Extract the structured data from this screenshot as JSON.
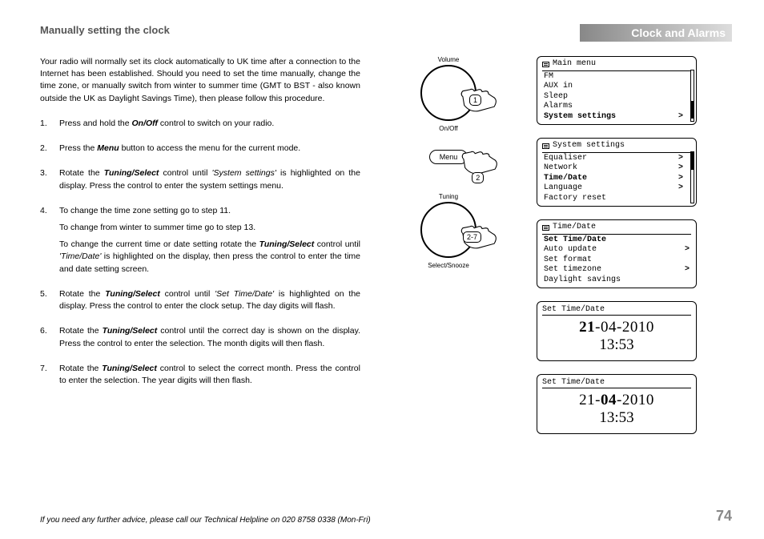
{
  "header": {
    "section_title": "Manually setting the clock",
    "chapter": "Clock and Alarms"
  },
  "intro": "Your radio will normally set its clock automatically to UK time after a connection to the Internet has been established. Should you need to set the time manually, change the time zone, or manually switch from winter to summer time (GMT to BST - also known outside the UK as Daylight Savings Time), then please follow this procedure.",
  "steps": {
    "s1_a": "Press and hold the ",
    "s1_b": "On/Off",
    "s1_c": " control to switch on your radio.",
    "s2_a": "Press the ",
    "s2_b": "Menu",
    "s2_c": " button to access the menu for the current mode.",
    "s3_a": "Rotate the ",
    "s3_b": "Tuning/Select",
    "s3_c": " control until ",
    "s3_d": "'System settings'",
    "s3_e": " is highlighted on the display. Press the control to enter the system settings menu.",
    "s4_a": "To change the time zone setting go to step 11.",
    "s4_b": "To change from winter to summer time go to step 13.",
    "s4_c1": "To change the current time or date setting rotate the ",
    "s4_c2": "Tuning/Select",
    "s4_c3": " control until ",
    "s4_c4": "'Time/Date'",
    "s4_c5": " is highlighted on the display, then press the control to enter the time and date setting screen.",
    "s5_a": "Rotate the ",
    "s5_b": "Tuning/Select",
    "s5_c": " control until ",
    "s5_d": "'Set Time/Date'",
    "s5_e": " is highlighted on the display. Press the control to enter the clock setup. The day digits will flash.",
    "s6_a": "Rotate the ",
    "s6_b": "Tuning/Select",
    "s6_c": " control until the correct day is shown on the display. Press the control to enter the selection. The month digits will then flash.",
    "s7_a": "Rotate the ",
    "s7_b": "Tuning/Select",
    "s7_c": " control to select the correct month. Press the control to enter the selection. The year digits will then flash."
  },
  "diagrams": {
    "d1": {
      "top": "Volume",
      "bottom": "On/Off",
      "badge": "1"
    },
    "d2": {
      "label": "Menu",
      "badge": "2"
    },
    "d3": {
      "top": "Tuning",
      "bottom": "Select/Snooze",
      "badge": "2-7"
    }
  },
  "screens": {
    "main_menu": {
      "title": "Main menu",
      "items": [
        {
          "label": "FM",
          "arrow": "",
          "bold": false
        },
        {
          "label": "AUX in",
          "arrow": "",
          "bold": false
        },
        {
          "label": "Sleep",
          "arrow": "",
          "bold": false
        },
        {
          "label": "Alarms",
          "arrow": "",
          "bold": false
        },
        {
          "label": "System settings",
          "arrow": ">",
          "bold": true
        }
      ],
      "scroll_thumb_top": "60%"
    },
    "system_settings": {
      "title": "System settings",
      "items": [
        {
          "label": "Equaliser",
          "arrow": ">",
          "bold": false
        },
        {
          "label": "Network",
          "arrow": ">",
          "bold": false
        },
        {
          "label": "Time/Date",
          "arrow": ">",
          "bold": true
        },
        {
          "label": "Language",
          "arrow": ">",
          "bold": false
        },
        {
          "label": "Factory reset",
          "arrow": "",
          "bold": false
        }
      ],
      "scroll_thumb_top": "0%"
    },
    "time_date": {
      "title": "Time/Date",
      "items": [
        {
          "label": "Set Time/Date",
          "arrow": "",
          "bold": true
        },
        {
          "label": "Auto update",
          "arrow": ">",
          "bold": false
        },
        {
          "label": "Set format",
          "arrow": "",
          "bold": false
        },
        {
          "label": "Set timezone",
          "arrow": ">",
          "bold": false
        },
        {
          "label": "Daylight savings",
          "arrow": "",
          "bold": false
        }
      ]
    },
    "set1": {
      "title": "Set Time/Date",
      "day": "21",
      "sep1": "-",
      "month": "04",
      "sep2": "-",
      "year": "2010",
      "time": "13:53",
      "bold_part": "day"
    },
    "set2": {
      "title": "Set Time/Date",
      "day": "21",
      "sep1": "-",
      "month": "04",
      "sep2": "-",
      "year": "2010",
      "time": "13:53",
      "bold_part": "month"
    }
  },
  "footer": {
    "help": "If you need any further advice, please call our Technical Helpline on 020 8758 0338 (Mon-Fri)",
    "page": "74"
  }
}
